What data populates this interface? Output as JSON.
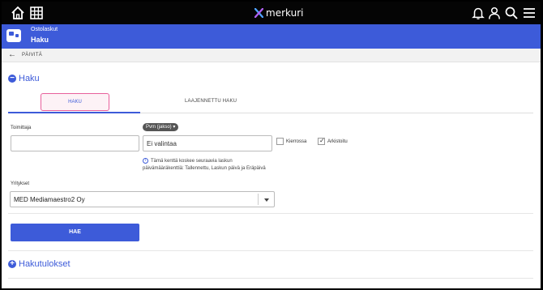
{
  "brand": {
    "name": "merkuri",
    "accent": "#3d5bd9",
    "logo_color": "#8e6cf0"
  },
  "header": {
    "breadcrumb": "Ostolaskut",
    "title": "Haku"
  },
  "actions": {
    "refresh_label": "PÄIVITÄ"
  },
  "search_section": {
    "title": "Haku"
  },
  "tabs": [
    {
      "label": "HAKU",
      "active": true
    },
    {
      "label": "LAAJENNETTU HAKU",
      "active": false
    }
  ],
  "form": {
    "supplier_label": "Toimittaja",
    "supplier_value": "",
    "date_chip_label": "Pvm (jakso)",
    "date_value": "Ei valintaa",
    "circulating_label": "Kierrossa",
    "circulating_checked": false,
    "archived_label": "Arkistoitu",
    "archived_checked": true,
    "info_text": "Tämä kenttä koskee seuraavia laskun päivämääräkenttiä: Tallennettu, Laskun päivä ja Eräpäivä",
    "companies_label": "Yritykset",
    "company_value": "MED Mediamaestro2 Oy",
    "search_button_label": "HAE"
  },
  "results_section": {
    "title": "Hakutulokset"
  }
}
